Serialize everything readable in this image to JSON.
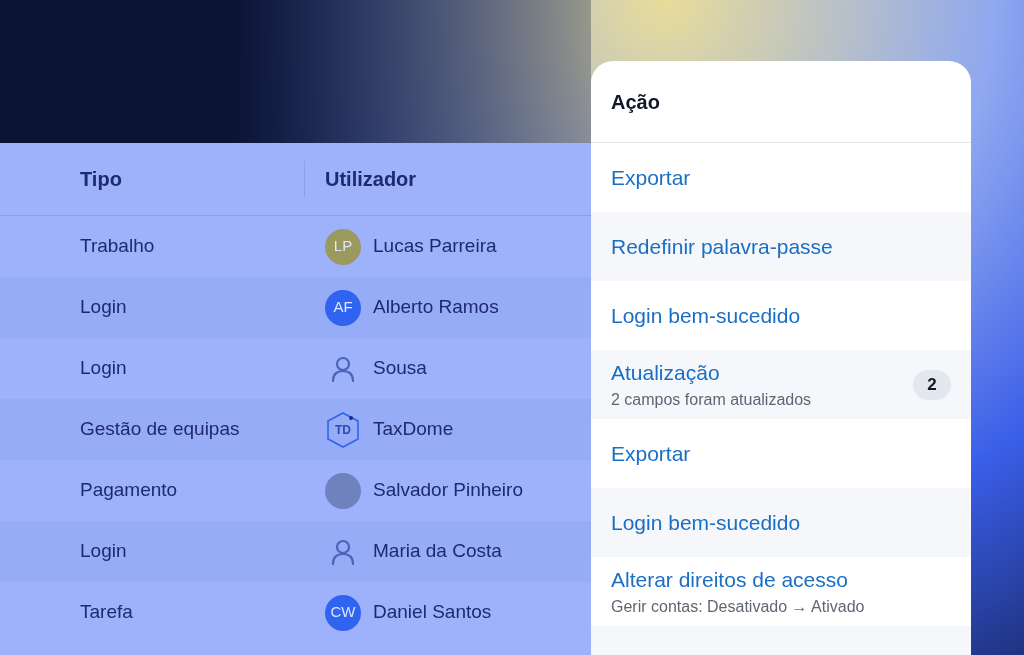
{
  "table": {
    "columns": [
      "Tipo",
      "Utilizador"
    ],
    "rows": [
      {
        "type": "Trabalho",
        "user": {
          "name": "Lucas Parreira",
          "avatar": {
            "kind": "initials",
            "text": "LP",
            "color": "#9a9a5e"
          }
        }
      },
      {
        "type": "Login",
        "user": {
          "name": "Alberto Ramos",
          "avatar": {
            "kind": "initials",
            "text": "AF",
            "color": "#2f63f0"
          }
        }
      },
      {
        "type": "Login",
        "user": {
          "name": "Sousa",
          "avatar": {
            "kind": "person"
          }
        }
      },
      {
        "type": "Gestão de equipas",
        "user": {
          "name": "TaxDome",
          "avatar": {
            "kind": "logo",
            "text": "TD"
          }
        }
      },
      {
        "type": "Pagamento",
        "user": {
          "name": "Salvador Pinheiro",
          "avatar": {
            "kind": "photo"
          }
        }
      },
      {
        "type": "Login",
        "user": {
          "name": "Maria da Costa",
          "avatar": {
            "kind": "person"
          }
        }
      },
      {
        "type": "Tarefa",
        "user": {
          "name": "Daniel Santos",
          "avatar": {
            "kind": "initials",
            "text": "CW",
            "color": "#2f63f0"
          }
        }
      }
    ]
  },
  "action_panel": {
    "title": "Ação",
    "items": [
      {
        "label": "Exportar"
      },
      {
        "label": "Redefinir palavra-passe"
      },
      {
        "label": "Login bem-sucedido"
      },
      {
        "label": "Atualização",
        "detail": "2 campos foram atualizados",
        "count": "2"
      },
      {
        "label": "Exportar"
      },
      {
        "label": "Login bem-sucedido"
      },
      {
        "label": "Alterar direitos de acesso",
        "detail": "Gerir contas: Desativado → Ativado"
      }
    ]
  }
}
